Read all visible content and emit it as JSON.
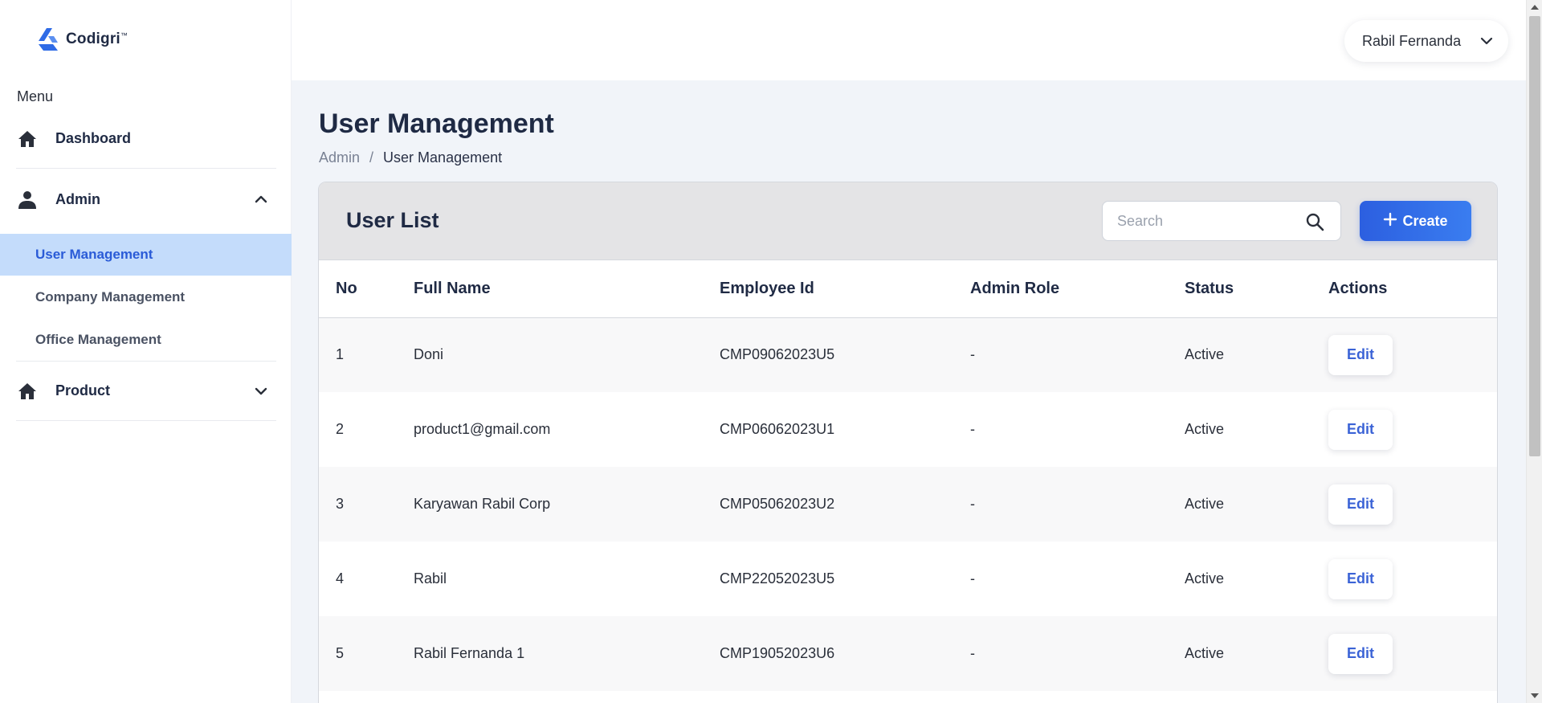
{
  "brand": {
    "name": "Codigri",
    "mark": "™"
  },
  "sidebar": {
    "caption": "Menu",
    "items": [
      {
        "label": "Dashboard",
        "icon": "home-icon"
      },
      {
        "label": "Admin",
        "icon": "user-icon",
        "expanded": true,
        "children": [
          {
            "label": "User Management",
            "active": true
          },
          {
            "label": "Company Management"
          },
          {
            "label": "Office Management"
          }
        ]
      },
      {
        "label": "Product",
        "icon": "home-icon",
        "expanded": false
      }
    ]
  },
  "header": {
    "user_name": "Rabil Fernanda"
  },
  "page": {
    "title": "User Management",
    "breadcrumb": {
      "parent": "Admin",
      "separator": "/",
      "current": "User Management"
    }
  },
  "card": {
    "title": "User List",
    "search_placeholder": "Search",
    "create_label": "Create"
  },
  "table": {
    "columns": [
      "No",
      "Full Name",
      "Employee Id",
      "Admin Role",
      "Status",
      "Actions"
    ],
    "rows": [
      {
        "no": "1",
        "name": "Doni",
        "employee_id": "CMP09062023U5",
        "role": "-",
        "status": "Active",
        "action": "Edit"
      },
      {
        "no": "2",
        "name": "product1@gmail.com",
        "employee_id": "CMP06062023U1",
        "role": "-",
        "status": "Active",
        "action": "Edit"
      },
      {
        "no": "3",
        "name": "Karyawan Rabil Corp",
        "employee_id": "CMP05062023U2",
        "role": "-",
        "status": "Active",
        "action": "Edit"
      },
      {
        "no": "4",
        "name": "Rabil",
        "employee_id": "CMP22052023U5",
        "role": "-",
        "status": "Active",
        "action": "Edit"
      },
      {
        "no": "5",
        "name": "Rabil Fernanda 1",
        "employee_id": "CMP19052023U6",
        "role": "-",
        "status": "Active",
        "action": "Edit"
      }
    ]
  },
  "colors": {
    "accent": "#2c5fe0",
    "active_bg": "#c4dcfb",
    "active_text": "#2a5bd7",
    "text": "#1f2a44"
  }
}
